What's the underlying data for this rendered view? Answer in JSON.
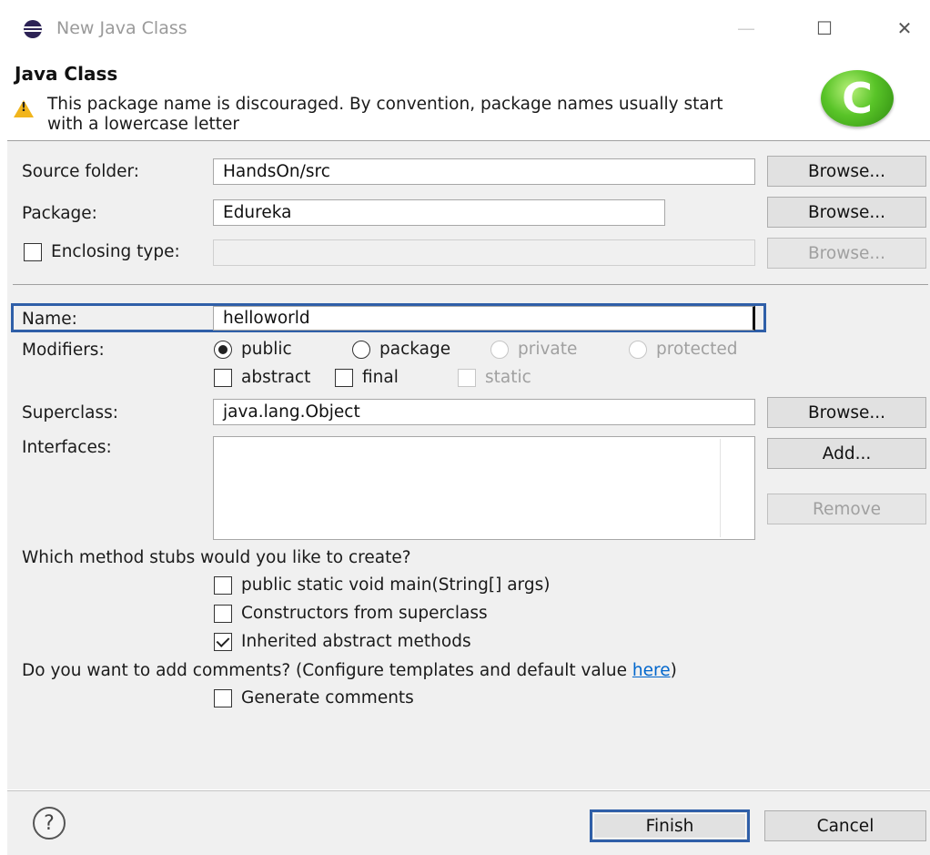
{
  "window": {
    "title": "New Java Class",
    "minimize": "—",
    "maximize": "☐",
    "close": "✕"
  },
  "banner": {
    "title": "Java Class",
    "warning_line1": "This package name is discouraged. By convention, package names usually start",
    "warning_line2": "with a lowercase letter",
    "logo_letter": "C"
  },
  "form": {
    "source_folder": {
      "label": "Source folder:",
      "value": "HandsOn/src",
      "browse": "Browse..."
    },
    "package": {
      "label": "Package:",
      "value": "Edureka",
      "browse": "Browse..."
    },
    "enclosing_type": {
      "label": "Enclosing type:",
      "value": "",
      "browse": "Browse...",
      "checked": false
    },
    "name": {
      "label": "Name:",
      "value": "helloworld"
    },
    "modifiers": {
      "label": "Modifiers:",
      "radios": [
        {
          "label": "public",
          "checked": true,
          "enabled": true
        },
        {
          "label": "package",
          "checked": false,
          "enabled": true
        },
        {
          "label": "private",
          "checked": false,
          "enabled": false
        },
        {
          "label": "protected",
          "checked": false,
          "enabled": false
        }
      ],
      "checks": [
        {
          "label": "abstract",
          "checked": false,
          "enabled": true
        },
        {
          "label": "final",
          "checked": false,
          "enabled": true
        },
        {
          "label": "static",
          "checked": false,
          "enabled": false
        }
      ]
    },
    "superclass": {
      "label": "Superclass:",
      "value": "java.lang.Object",
      "browse": "Browse..."
    },
    "interfaces": {
      "label": "Interfaces:",
      "add": "Add...",
      "remove": "Remove"
    },
    "stubs": {
      "question": "Which method stubs would you like to create?",
      "options": [
        {
          "label": "public static void main(String[] args)",
          "checked": false
        },
        {
          "label": "Constructors from superclass",
          "checked": false
        },
        {
          "label": "Inherited abstract methods",
          "checked": true
        }
      ]
    },
    "comments": {
      "question": "Do you want to add comments? (Configure templates and default value ",
      "link": "here",
      "close_paren": ")",
      "generate_label": "Generate comments",
      "checked": false
    }
  },
  "footer": {
    "help": "?",
    "finish": "Finish",
    "cancel": "Cancel"
  },
  "colors": {
    "focus_border": "#2f5fa8",
    "link": "#0066cc",
    "panel_bg": "#f0f0f0"
  }
}
